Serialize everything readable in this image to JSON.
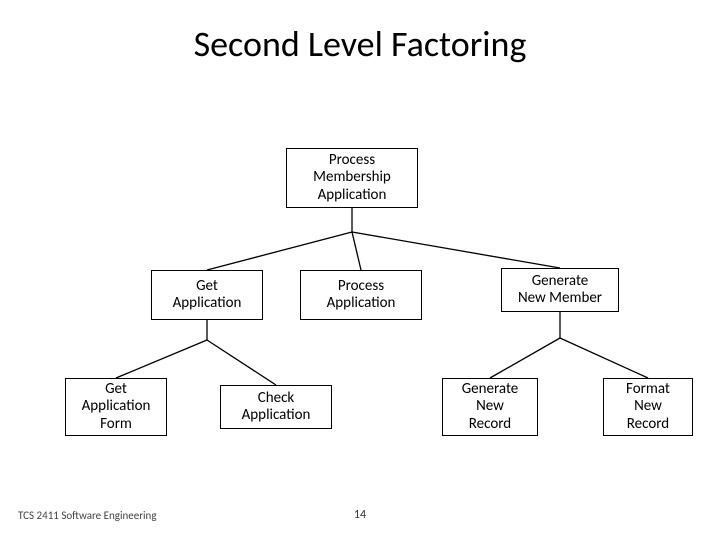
{
  "title": "Second Level Factoring",
  "nodes": {
    "root": "Process\nMembership\nApplication",
    "l2a": "Get\nApplication",
    "l2b": "Process\nApplication",
    "l2c": "Generate\nNew Member",
    "l3a": "Get\nApplication\nForm",
    "l3b": "Check\nApplication",
    "l3c": "Generate\nNew\nRecord",
    "l3d": "Format\nNew\nRecord"
  },
  "footer": {
    "course": "TCS 2411 Software Engineering",
    "page": "14"
  }
}
